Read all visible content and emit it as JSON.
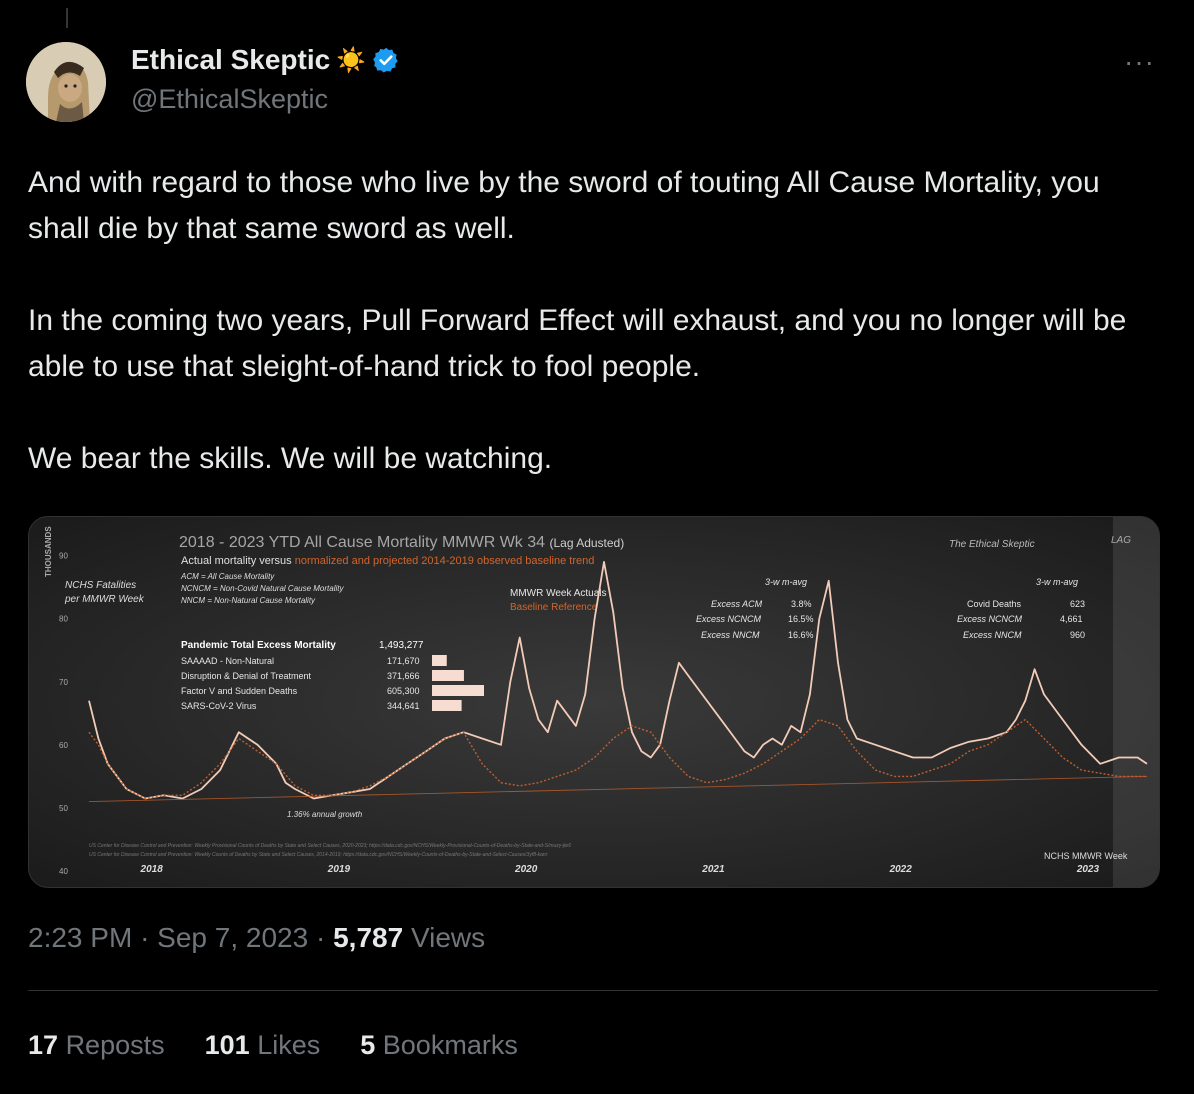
{
  "author": {
    "name": "Ethical Skeptic",
    "handle": "@EthicalSkeptic",
    "emoji": "☀️",
    "verified_badge_color": "#1d9bf0"
  },
  "tweet": {
    "paragraphs": [
      "And with regard to those who live by the sword of touting All Cause Mortality, you shall die by that same sword as well.",
      "In the coming two years, Pull Forward Effect will  exhaust, and you no longer will be able to use that sleight-of-hand trick to fool people.",
      "We bear the skills. We will be watching."
    ],
    "more_label": "···"
  },
  "meta": {
    "time": "2:23 PM",
    "date": "Sep 7, 2023",
    "views_count": "5,787",
    "views_label": "Views",
    "separator": "·"
  },
  "stats": {
    "reposts_count": "17",
    "reposts_label": "Reposts",
    "likes_count": "101",
    "likes_label": "Likes",
    "bookmarks_count": "5",
    "bookmarks_label": "Bookmarks"
  },
  "chart_data": {
    "type": "line",
    "title": "2018 - 2023 YTD All Cause Mortality MMWR Wk 34",
    "title_suffix": "(Lag Adusted)",
    "subtitle_prefix": "Actual mortality versus",
    "subtitle_highlight": "normalized and projected 2014-2019 observed baseline trend",
    "watermark": "The Ethical Skeptic",
    "lag_label": "LAG",
    "ylabel_units": "THOUSANDS",
    "ylabel": "NCHS Fatalities per MMWR Week",
    "ylabel_line1": "NCHS Fatalities",
    "ylabel_line2": "per MMWR Week",
    "yticks": [
      40,
      50,
      60,
      70,
      80,
      90
    ],
    "ylim": [
      40,
      92
    ],
    "xlabel": "NCHS MMWR Week",
    "x_tick_labels": [
      "2018",
      "2019",
      "2020",
      "2021",
      "2022",
      "2023"
    ],
    "definitions": [
      "ACM = All Cause Mortality",
      "NCNCM = Non-Covid Natural Cause Mortality",
      "NNCM = Non-Natural Cause Mortality"
    ],
    "legend": {
      "actual": "MMWR Week Actuals",
      "baseline": "Baseline Reference"
    },
    "trend_annotation": "1.36% annual growth",
    "pandemic_table": {
      "header_label": "Pandemic Total Excess Mortality",
      "header_value": "1,493,277",
      "rows": [
        {
          "label": "SAAAAD - Non-Natural",
          "value": "171,670",
          "amount": 171670
        },
        {
          "label": "Disruption & Denial of Treatment",
          "value": "371,666",
          "amount": 371666
        },
        {
          "label": "Factor V and Sudden Deaths",
          "value": "605,300",
          "amount": 605300
        },
        {
          "label": "SARS-CoV-2 Virus",
          "value": "344,641",
          "amount": 344641
        }
      ]
    },
    "stats_2021": {
      "header": "3-w m-avg",
      "rows": [
        {
          "label": "Excess ACM",
          "value": "3.8%"
        },
        {
          "label": "Excess NCNCM",
          "value": "16.5%"
        },
        {
          "label": "Excess NNCM",
          "value": "16.6%"
        }
      ]
    },
    "stats_2023": {
      "header": "3-w m-avg",
      "rows": [
        {
          "label": "Covid Deaths",
          "value": "623"
        },
        {
          "label": "Excess NCNCM",
          "value": "4,661"
        },
        {
          "label": "Excess NNCM",
          "value": "960"
        }
      ]
    },
    "sources": [
      "US Center for Disease Control and Prevention: Weekly Provisional Counts of Deaths by State and Select Causes, 2020-2023; https://data.cdc.gov/NCHS/Weekly-Provisional-Counts-of-Deaths-by-State-and-S/muzy-jte6",
      "US Center for Disease Control and Prevention: Weekly Counts of Deaths by State and Select Causes, 2014-2019; https://data.cdc.gov/NCHS/Weekly-Counts-of-Deaths-by-State-and-Select-Causes/3yf8-kanr"
    ],
    "series": [
      {
        "name": "MMWR Week Actuals",
        "color": "#f2ccb8",
        "x": [
          2018.0,
          2018.05,
          2018.1,
          2018.2,
          2018.3,
          2018.4,
          2018.5,
          2018.6,
          2018.7,
          2018.8,
          2018.9,
          2019.0,
          2019.05,
          2019.1,
          2019.2,
          2019.3,
          2019.4,
          2019.5,
          2019.6,
          2019.7,
          2019.8,
          2019.9,
          2020.0,
          2020.1,
          2020.2,
          2020.25,
          2020.3,
          2020.35,
          2020.4,
          2020.45,
          2020.5,
          2020.55,
          2020.6,
          2020.65,
          2020.7,
          2020.75,
          2020.8,
          2020.85,
          2020.9,
          2020.95,
          2021.0,
          2021.05,
          2021.1,
          2021.15,
          2021.2,
          2021.3,
          2021.4,
          2021.45,
          2021.5,
          2021.55,
          2021.6,
          2021.65,
          2021.7,
          2021.75,
          2021.8,
          2021.85,
          2021.9,
          2021.95,
          2022.0,
          2022.05,
          2022.1,
          2022.2,
          2022.3,
          2022.4,
          2022.5,
          2022.6,
          2022.7,
          2022.8,
          2022.85,
          2022.9,
          2022.95,
          2023.0,
          2023.05,
          2023.1,
          2023.2,
          2023.3,
          2023.4,
          2023.5,
          2023.6,
          2023.65
        ],
        "y": [
          67,
          61,
          57,
          53,
          51.5,
          52,
          51.5,
          53,
          56,
          62,
          60,
          57,
          54,
          53,
          51.5,
          52,
          52.5,
          53,
          55,
          57,
          59,
          61,
          62,
          61,
          60,
          70,
          77,
          69,
          64,
          62,
          67,
          65,
          63,
          68,
          80,
          89,
          81,
          69,
          62,
          59,
          58,
          60,
          67,
          73,
          71,
          67,
          63,
          61,
          59,
          58,
          60,
          61,
          60,
          63,
          62,
          68,
          80,
          86,
          73,
          64,
          61,
          60,
          59,
          58,
          58,
          59.5,
          60.5,
          61,
          61.5,
          62,
          64,
          67,
          72,
          68,
          64,
          60,
          57,
          58,
          58,
          57
        ]
      },
      {
        "name": "Baseline Reference",
        "color": "#c0602e",
        "x": [
          2018.0,
          2018.05,
          2018.1,
          2018.2,
          2018.3,
          2018.4,
          2018.5,
          2018.6,
          2018.7,
          2018.8,
          2018.9,
          2019.0,
          2019.1,
          2019.2,
          2019.3,
          2019.4,
          2019.5,
          2019.6,
          2019.7,
          2019.8,
          2019.9,
          2020.0,
          2020.1,
          2020.2,
          2020.3,
          2020.4,
          2020.5,
          2020.6,
          2020.7,
          2020.8,
          2020.9,
          2021.0,
          2021.1,
          2021.2,
          2021.3,
          2021.4,
          2021.5,
          2021.6,
          2021.7,
          2021.8,
          2021.9,
          2022.0,
          2022.1,
          2022.2,
          2022.3,
          2022.4,
          2022.5,
          2022.6,
          2022.7,
          2022.8,
          2022.9,
          2023.0,
          2023.1,
          2023.2,
          2023.3,
          2023.4,
          2023.5,
          2023.6,
          2023.65
        ],
        "y": [
          62,
          60,
          57,
          53,
          51.5,
          52,
          52,
          54,
          57,
          61,
          59,
          57,
          53.5,
          52,
          52,
          52.5,
          53.5,
          55,
          57,
          59,
          61,
          62,
          57,
          54,
          53.5,
          54,
          55,
          56,
          58,
          61,
          63,
          62,
          58,
          55,
          54,
          54.5,
          55.5,
          57,
          59,
          61,
          64,
          63,
          59,
          56,
          55,
          55,
          56,
          57,
          59,
          60,
          62,
          64,
          61,
          58,
          56,
          55.5,
          55,
          55,
          55
        ]
      },
      {
        "name": "trend",
        "color": "#c0602e",
        "x": [
          2018.0,
          2023.65
        ],
        "y": [
          51,
          55
        ]
      }
    ]
  }
}
